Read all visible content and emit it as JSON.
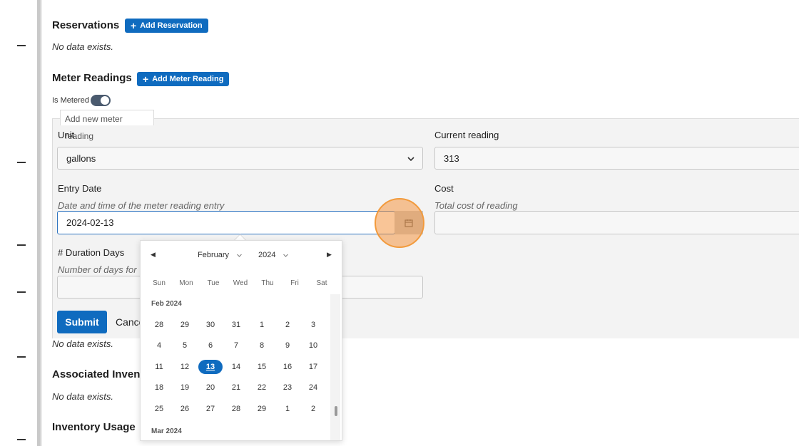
{
  "reservations": {
    "title": "Reservations",
    "add_label": "Add Reservation",
    "empty_text": "No data exists."
  },
  "meter_readings": {
    "title": "Meter Readings",
    "add_label": "Add Meter Reading",
    "toggle_label": "Is Metered",
    "toggle_on": true,
    "form_legend": "Add new meter reading",
    "unit_label": "Unit",
    "unit_value": "gallons",
    "current_reading_label": "Current reading",
    "current_reading_value": "313",
    "entry_date_label": "Entry Date",
    "entry_date_help": "Date and time of the meter reading entry",
    "entry_date_value": "2024-02-13",
    "cost_label": "Cost",
    "cost_help": "Total cost of reading",
    "cost_value": "",
    "duration_label": "# Duration Days",
    "duration_help": "Number of days for",
    "duration_value": "",
    "submit_label": "Submit",
    "cancel_label": "Cance",
    "empty_text": "No data exists."
  },
  "associated_inventory": {
    "title": "Associated Invent",
    "empty_text": "No data exists."
  },
  "inventory_usage": {
    "title": "Inventory Usage"
  },
  "date_picker": {
    "month": "February",
    "year": "2024",
    "weekdays": [
      "Sun",
      "Mon",
      "Tue",
      "Wed",
      "Thu",
      "Fri",
      "Sat"
    ],
    "group1_title": "Feb 2024",
    "group2_title": "Mar 2024",
    "selected_day": "13",
    "weeks": [
      [
        "28",
        "29",
        "30",
        "31",
        "1",
        "2",
        "3"
      ],
      [
        "4",
        "5",
        "6",
        "7",
        "8",
        "9",
        "10"
      ],
      [
        "11",
        "12",
        "13",
        "14",
        "15",
        "16",
        "17"
      ],
      [
        "18",
        "19",
        "20",
        "21",
        "22",
        "23",
        "24"
      ],
      [
        "25",
        "26",
        "27",
        "28",
        "29",
        "1",
        "2"
      ]
    ]
  },
  "colors": {
    "accent": "#0f6bbf",
    "highlight": "#f29a3c"
  },
  "icons": {
    "calendar": "calendar-icon",
    "chevron": "chevron-down-icon",
    "prev": "caret-left-icon",
    "next": "caret-right-icon"
  }
}
